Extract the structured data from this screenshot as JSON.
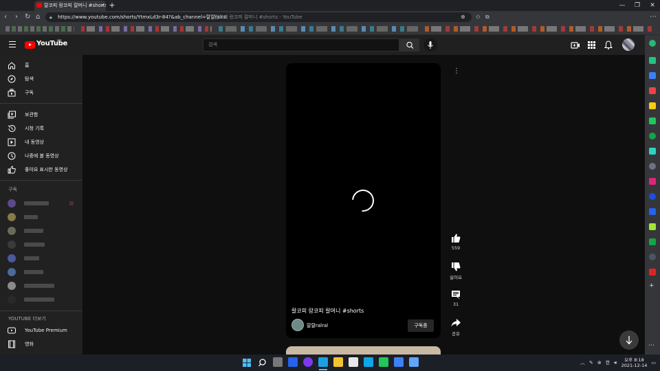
{
  "browser": {
    "tab_title": "랄코피 랑코피 랄머니 #shorts",
    "tab_close": "×",
    "new_tab": "+",
    "window_controls": [
      "—",
      "❐",
      "✕"
    ],
    "url": "https://www.youtube.com/shorts/YtmxLd3r-84?&ab_channel=랄랄ralral",
    "url_suffix_title": "랄코피 랑코피 랄머니 #shorts - YouTube"
  },
  "header": {
    "logo_text": "YouTube",
    "logo_region": "KR",
    "search_placeholder": "검색"
  },
  "guide": {
    "main": [
      {
        "label": "홈",
        "icon": "home-icon"
      },
      {
        "label": "탐색",
        "icon": "compass-icon"
      },
      {
        "label": "구독",
        "icon": "subscriptions-icon"
      }
    ],
    "library": [
      {
        "label": "보관함",
        "icon": "library-icon"
      },
      {
        "label": "시청 기록",
        "icon": "history-icon"
      },
      {
        "label": "내 동영상",
        "icon": "my-videos-icon"
      },
      {
        "label": "나중에 볼 동영상",
        "icon": "watch-later-icon"
      },
      {
        "label": "좋아요 표시한 동영상",
        "icon": "liked-videos-icon"
      }
    ],
    "subscriptions_heading": "구독",
    "more_heading": "YOUTUBE 더보기",
    "more": [
      {
        "label": "YouTube Premium",
        "icon": "youtube-premium-icon"
      },
      {
        "label": "영화",
        "icon": "movies-icon"
      }
    ]
  },
  "short": {
    "title": "랄코피 랑코피 랄머니 #shorts",
    "channel": "랄랄ralral",
    "subscribe_label": "구독중"
  },
  "actions": {
    "likes": "559",
    "dislike_label": "싫어요",
    "comments": "31",
    "share_label": "공유"
  },
  "taskbar": {
    "ime": "한",
    "time": "오후 8:18",
    "date": "2021-12-14"
  },
  "colors": {
    "youtube_red": "#ff0000",
    "background": "#0f0f0f",
    "guide": "#212121"
  }
}
